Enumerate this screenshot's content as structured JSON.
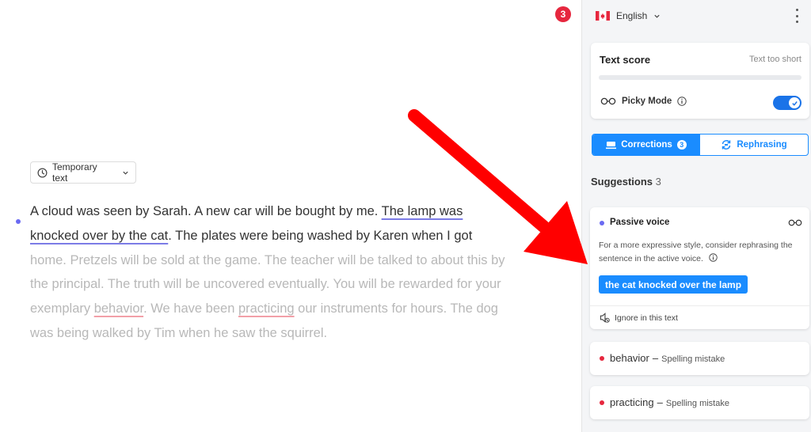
{
  "editor": {
    "temp_button_label": "Temporary text",
    "text_active_1": "A cloud was seen by Sarah. A new car will be bought by me. ",
    "passive_phrase": "The lamp was knocked over by the cat",
    "text_active_2": ". The plates were being washed by Karen when I got",
    "text_inactive_1": " home. Pretzels will be sold at the game. The teacher will be talked to about this by the principal. The truth will be uncovered eventually. You will be rewarded for your exemplary ",
    "spell_word_1": "behavior",
    "text_inactive_2": ". We have been ",
    "spell_word_2": "practicing",
    "text_inactive_3": " our instruments for hours. The dog was being walked by Tim when he saw the squirrel."
  },
  "header": {
    "issue_count": "3",
    "language": "English"
  },
  "score": {
    "title": "Text score",
    "status": "Text too short",
    "picky_mode_label": "Picky Mode",
    "picky_mode_on": true
  },
  "tabs": {
    "corrections_label": "Corrections",
    "corrections_count": "3",
    "rephrasing_label": "Rephrasing"
  },
  "suggestions": {
    "heading": "Suggestions",
    "count": "3",
    "passive": {
      "title": "Passive voice",
      "description": "For a more expressive style, consider rephrasing the sentence in the active voice.",
      "fix": "the cat knocked over the lamp",
      "ignore_label": "Ignore in this text"
    },
    "spelling": [
      {
        "word": "behavior",
        "type": "Spelling mistake"
      },
      {
        "word": "practicing",
        "type": "Spelling mistake"
      }
    ]
  },
  "colors": {
    "accent": "#1a8cff",
    "passive_dot": "#6a6af2",
    "error_red": "#e6273e",
    "arrow_red": "#ff0000"
  }
}
